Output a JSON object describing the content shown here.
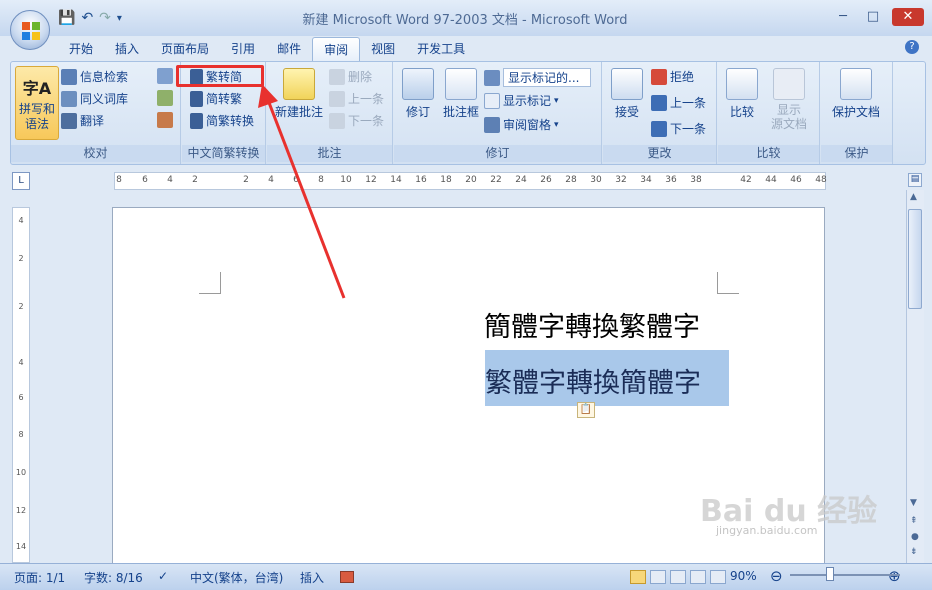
{
  "window": {
    "title": "新建 Microsoft Word 97-2003 文档 - Microsoft Word",
    "minimize": "─",
    "maximize": "□",
    "close": "✕"
  },
  "qat": {
    "save": "💾",
    "undo": "↶",
    "redo": "↷",
    "more": "▾"
  },
  "tabs": [
    "开始",
    "插入",
    "页面布局",
    "引用",
    "邮件",
    "审阅",
    "视图",
    "开发工具"
  ],
  "active_tab": "审阅",
  "help": "?",
  "ribbon": {
    "proofing": {
      "spelling": "拼写和\n语法",
      "research": "信息检索",
      "thesaurus": "同义词库",
      "translate": "翻译",
      "label": "校对"
    },
    "chinese": {
      "to_simplified": "繁转简",
      "to_traditional": "简转繁",
      "convert": "简繁转换",
      "label": "中文简繁转换"
    },
    "comments": {
      "new_comment": "新建批注",
      "delete": "删除",
      "previous": "上一条",
      "next": "下一条",
      "label": "批注"
    },
    "tracking": {
      "track_changes": "修订",
      "balloons": "批注框",
      "markup_dropdown": "显示标记的...",
      "show_markup": "显示标记",
      "reviewing_pane": "审阅窗格",
      "label": "修订"
    },
    "changes": {
      "accept": "接受",
      "reject": "拒绝",
      "previous": "上一条",
      "next": "下一条",
      "label": "更改"
    },
    "compare": {
      "compare": "比较",
      "show_source": "显示\n源文档",
      "label": "比较"
    },
    "protect": {
      "protect_doc": "保护文档",
      "label": "保护"
    }
  },
  "ruler": {
    "h_ticks": [
      "8",
      "6",
      "4",
      "2",
      "2",
      "4",
      "6",
      "8",
      "10",
      "12",
      "14",
      "16",
      "18",
      "20",
      "22",
      "24",
      "26",
      "28",
      "30",
      "32",
      "34",
      "36",
      "38",
      "42",
      "44",
      "46",
      "48"
    ],
    "v_ticks": [
      "4",
      "2",
      "2",
      "4",
      "6",
      "8",
      "10",
      "12",
      "14"
    ]
  },
  "document": {
    "line1": "簡體字轉換繁體字",
    "line2": "繁體字轉換簡體字"
  },
  "status": {
    "page": "页面: 1/1",
    "words": "字数: 8/16",
    "language": "中文(繁体，台湾)",
    "insert_mode": "插入",
    "zoom": "90%"
  },
  "watermark": {
    "brand": "Bai du 经验",
    "url": "jingyan.baidu.com"
  },
  "colors": {
    "highlight": "#e8312e",
    "selection": "#a9c8ea",
    "ribbon": "#dfe9f5"
  }
}
